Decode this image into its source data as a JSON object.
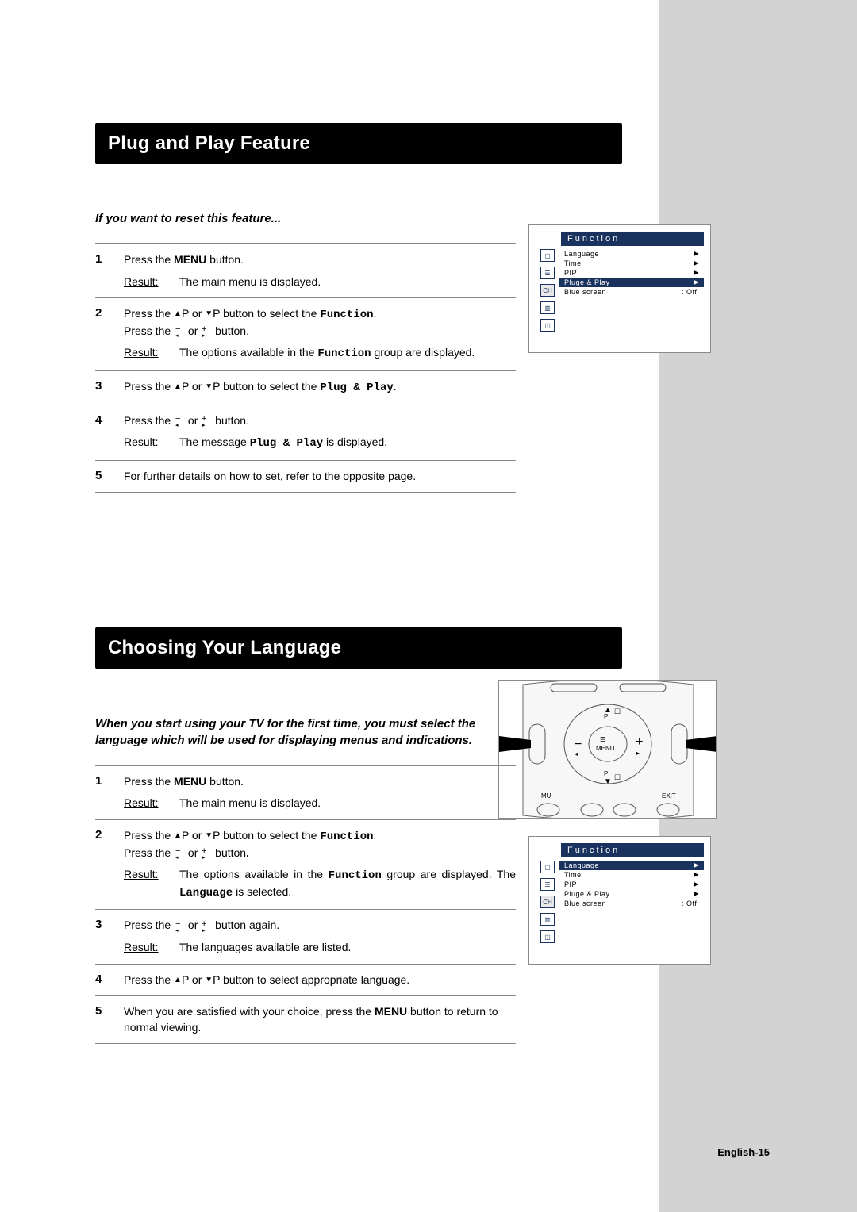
{
  "section1": {
    "title": "Plug and Play Feature",
    "intro": "If you want to reset this feature...",
    "steps": {
      "s1_num": "1",
      "s1_text_a": "Press the ",
      "s1_menu": "MENU",
      "s1_text_b": " button.",
      "s1_result_label": "Result:",
      "s1_result": "The main menu is displayed.",
      "s2_num": "2",
      "s2_text_a": "Press the ",
      "s2_text_b": "P or ",
      "s2_text_c": "P button to select the ",
      "s2_function": "Function",
      "s2_text_d": ".",
      "s2_line2_a": "Press the ",
      "s2_line2_b": " or ",
      "s2_line2_c": " button.",
      "s2_result_label": "Result:",
      "s2_result_a": "The options available in the ",
      "s2_result_function": "Function",
      "s2_result_b": " group are displayed.",
      "s3_num": "3",
      "s3_text_a": "Press the ",
      "s3_text_b": "P or ",
      "s3_text_c": "P button to select the ",
      "s3_plugplay": "Plug & Play",
      "s3_text_d": ".",
      "s4_num": "4",
      "s4_text_a": "Press the ",
      "s4_text_b": " or ",
      "s4_text_c": " button.",
      "s4_result_label": "Result:",
      "s4_result_a": "The message ",
      "s4_result_pp": "Plug & Play",
      "s4_result_b": " is displayed.",
      "s5_num": "5",
      "s5_text": "For further details on how to set, refer to the opposite page."
    }
  },
  "section2": {
    "title": "Choosing Your Language",
    "intro": "When you start using your TV for the first time, you must select the language which will be used for displaying menus and indications.",
    "steps": {
      "s1_num": "1",
      "s1_text_a": "Press the ",
      "s1_menu": "MENU",
      "s1_text_b": " button.",
      "s1_result_label": "Result:",
      "s1_result": "The main menu is displayed.",
      "s2_num": "2",
      "s2_text_a": "Press the ",
      "s2_text_b": "P or ",
      "s2_text_c": "P button to select the ",
      "s2_function": "Function",
      "s2_text_d": ".",
      "s2_line2_a": "Press the ",
      "s2_line2_b": " or ",
      "s2_line2_c": " button",
      "s2_line2_d": ".",
      "s2_result_label": "Result:",
      "s2_result_a": "The options available in the ",
      "s2_result_function": "Function",
      "s2_result_b": " group are displayed. The ",
      "s2_result_lang": "Language",
      "s2_result_c": " is selected.",
      "s3_num": "3",
      "s3_text_a": "Press the ",
      "s3_text_b": " or ",
      "s3_text_c": " button again.",
      "s3_result_label": "Result:",
      "s3_result": "The languages available are listed.",
      "s4_num": "4",
      "s4_text_a": "Press the ",
      "s4_text_b": "P or ",
      "s4_text_c": "P button to select appropriate language.",
      "s5_num": "5",
      "s5_text_a": "When you are satisfied with your choice, press the ",
      "s5_menu": "MENU",
      "s5_text_b": " button to return to normal viewing."
    }
  },
  "osd": {
    "title": "Function",
    "rows": {
      "language": "Language",
      "time": "Time",
      "pip": "PIP",
      "plugplay": "Pluge & Play",
      "bluescreen": "Blue screen",
      "off": ": Off",
      "tri": "▶"
    }
  },
  "osd2": {
    "title": "Function",
    "rows": {
      "language": "Language",
      "time": "Time",
      "pip": "PIP",
      "plugplay": "Pluge & Play",
      "bluescreen": "Blue screen",
      "off": ": Off",
      "tri": "▶"
    }
  },
  "remote": {
    "menu_label": "MENU",
    "p_up": "P",
    "p_dn": "P",
    "mute": "MU",
    "exit": "EXIT"
  },
  "glyphs": {
    "tri_up": "▲",
    "tri_down": "▼",
    "vol_minus_top": "−",
    "vol_minus_bot": "◂",
    "vol_plus_top": "+",
    "vol_plus_bot": "▸"
  },
  "footer": "English-15"
}
